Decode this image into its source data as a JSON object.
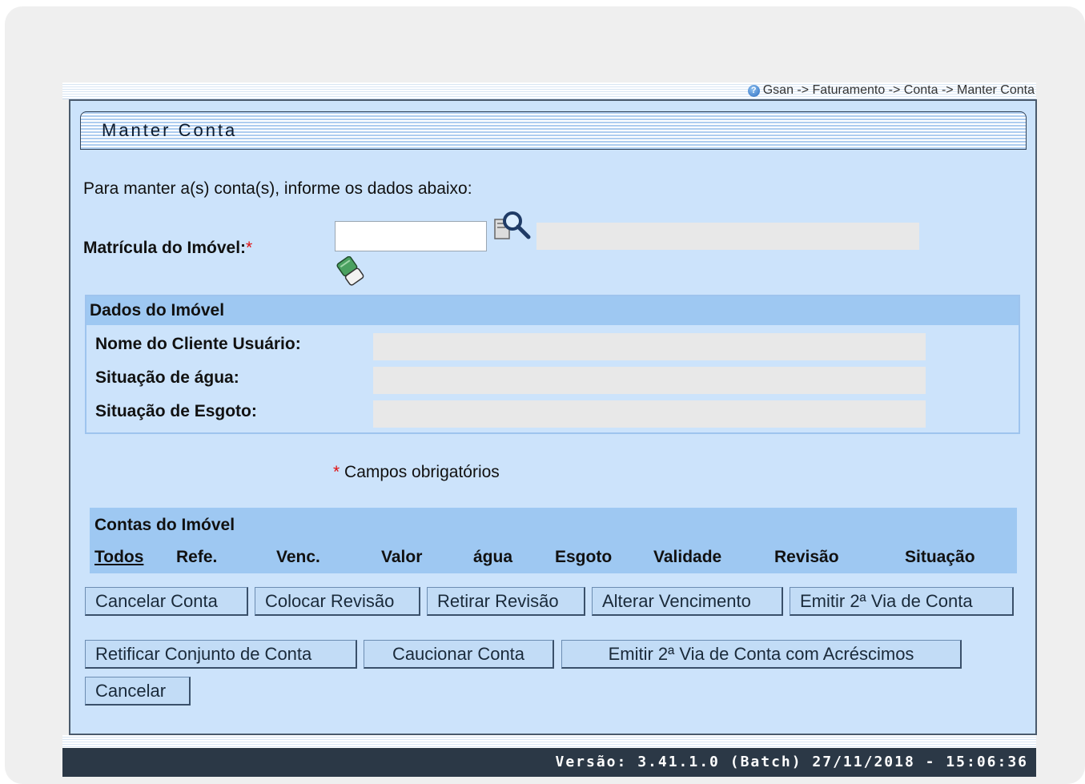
{
  "breadcrumb": "Gsan -> Faturamento -> Conta -> Manter Conta",
  "help_icon_glyph": "?",
  "page_title": "Manter Conta",
  "intro": "Para manter a(s) conta(s), informe os dados abaixo:",
  "matricula": {
    "label": "Matrícula do Imóvel:",
    "required_mark": "*",
    "value": ""
  },
  "dados_imovel": {
    "header": "Dados do Imóvel",
    "nome_cliente_label": "Nome do Cliente Usuário:",
    "situacao_agua_label": "Situação de água:",
    "situacao_esgoto_label": "Situação de Esgoto:"
  },
  "campos_obrigatorios": {
    "mark": "*",
    "text": "Campos obrigatórios"
  },
  "contas": {
    "title": "Contas do Imóvel",
    "columns": [
      "Todos",
      "Refe.",
      "Venc.",
      "Valor",
      "água",
      "Esgoto",
      "Validade",
      "Revisão",
      "Situação"
    ]
  },
  "buttons": {
    "cancelar_conta": "Cancelar Conta",
    "colocar_revisao": "Colocar Revisão",
    "retirar_revisao": "Retirar Revisão",
    "alterar_vencimento": "Alterar Vencimento",
    "emitir_segunda_via": "Emitir 2ª Via de Conta",
    "retificar_conjunto": "Retificar Conjunto de Conta",
    "caucionar_conta": "Caucionar Conta",
    "emitir_com_acrescimos": "Emitir 2ª Via de Conta com Acréscimos",
    "cancelar": "Cancelar"
  },
  "footer_version": "Versão: 3.41.1.0 (Batch) 27/11/2018 - 15:06:36",
  "icons": {
    "search": "magnifier-icon",
    "clear": "eraser-icon",
    "help": "help-icon"
  }
}
